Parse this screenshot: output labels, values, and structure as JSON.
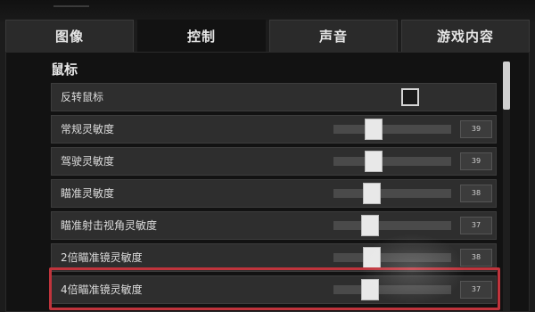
{
  "tabs": [
    {
      "label": "图像",
      "active": false
    },
    {
      "label": "控制",
      "active": true
    },
    {
      "label": "声音",
      "active": false
    },
    {
      "label": "游戏内容",
      "active": false
    }
  ],
  "section": {
    "title": "鼠标"
  },
  "rows": {
    "invert": {
      "label": "反转鼠标",
      "checked": false
    },
    "general": {
      "label": "常规灵敏度",
      "value": "39"
    },
    "vehicle": {
      "label": "驾驶灵敏度",
      "value": "39"
    },
    "aim": {
      "label": "瞄准灵敏度",
      "value": "38"
    },
    "aim_view": {
      "label": "瞄准射击视角灵敏度",
      "value": "37"
    },
    "scope2x": {
      "label": "2倍瞄准镜灵敏度",
      "value": "38"
    },
    "scope4x": {
      "label": "4倍瞄准镜灵敏度",
      "value": "37"
    }
  },
  "colors": {
    "highlight": "#c0343c",
    "panel": "#121212",
    "row": "#2e2e2e"
  }
}
